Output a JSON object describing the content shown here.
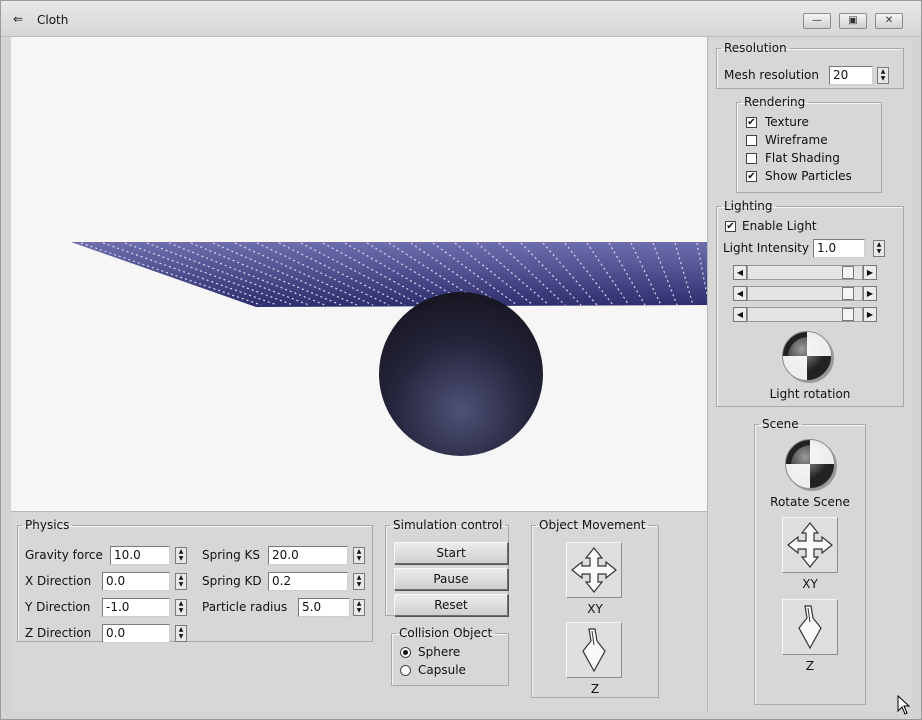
{
  "window": {
    "title": "Cloth"
  },
  "resolution": {
    "legend": "Resolution",
    "mesh_label": "Mesh resolution",
    "mesh_value": "20"
  },
  "rendering": {
    "legend": "Rendering",
    "options": [
      {
        "label": "Texture",
        "checked": true
      },
      {
        "label": "Wireframe",
        "checked": false
      },
      {
        "label": "Flat Shading",
        "checked": false
      },
      {
        "label": "Show Particles",
        "checked": true
      }
    ]
  },
  "lighting": {
    "legend": "Lighting",
    "enable_label": "Enable Light",
    "enable_checked": true,
    "intensity_label": "Light Intensity",
    "intensity_value": "1.0",
    "rotation_label": "Light rotation"
  },
  "scene": {
    "legend": "Scene",
    "rotate_label": "Rotate Scene",
    "xy_label": "XY",
    "z_label": "Z"
  },
  "physics": {
    "legend": "Physics",
    "gravity_label": "Gravity force",
    "gravity_value": "10.0",
    "xdir_label": "X Direction",
    "xdir_value": "0.0",
    "ydir_label": "Y Direction",
    "ydir_value": "-1.0",
    "zdir_label": "Z Direction",
    "zdir_value": "0.0",
    "ks_label": "Spring KS",
    "ks_value": "20.0",
    "kd_label": "Spring KD",
    "kd_value": "0.2",
    "radius_label": "Particle radius",
    "radius_value": "5.0"
  },
  "simulation": {
    "legend": "Simulation control",
    "start": "Start",
    "pause": "Pause",
    "reset": "Reset"
  },
  "collision": {
    "legend": "Collision Object",
    "options": [
      {
        "label": "Sphere",
        "selected": true
      },
      {
        "label": "Capsule",
        "selected": false
      }
    ]
  },
  "movement": {
    "legend": "Object Movement",
    "xy_label": "XY",
    "z_label": "Z"
  },
  "icons": {
    "back": "back-arrow-icon",
    "minimize": "minimize-icon",
    "maximize": "maximize-icon",
    "close": "close-icon",
    "move_xy": "move-xy-icon",
    "move_z": "move-z-icon",
    "rotate": "rotate-ball-icon",
    "cursor": "mouse-cursor-icon"
  },
  "colors": {
    "cloth": "#3a3a7a",
    "sphere": "#2c2c48",
    "background": "#f6f6f6",
    "panel": "#d7d7d7"
  }
}
